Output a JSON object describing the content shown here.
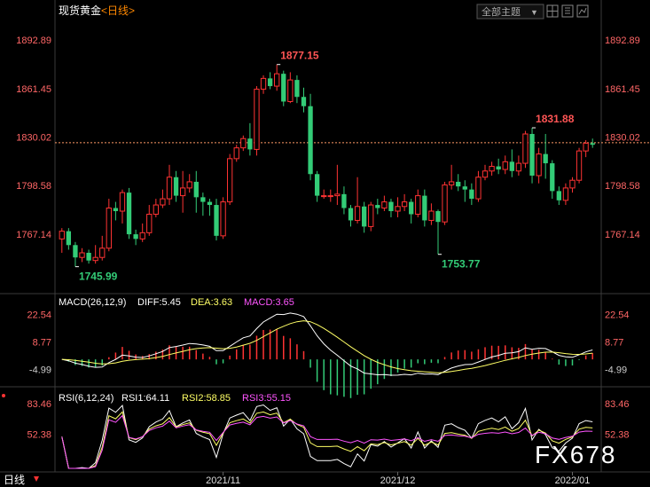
{
  "header": {
    "instrument": "现货黄金",
    "period": "<日线>",
    "theme_button": "全部主题",
    "theme_arrow": "▼"
  },
  "colors": {
    "up": "#ff3333",
    "down": "#33cc77",
    "axis_text_up": "#ff6666",
    "diff": "#ffffff",
    "dea": "#ffff66",
    "macd": "#ff55ff",
    "rsi2": "#ffff66",
    "rsi3": "#ff55ff",
    "grid": "#333333",
    "last_price_line": "#ff9966"
  },
  "price_axis": {
    "labels": [
      "1892.89",
      "1861.45",
      "1830.02",
      "1798.58",
      "1767.14"
    ],
    "values": [
      1892.89,
      1861.45,
      1830.02,
      1798.58,
      1767.14
    ],
    "range": [
      1732,
      1905
    ]
  },
  "annotations": {
    "high": "1877.15",
    "mid_high": "1831.88",
    "low1": "1745.99",
    "low2": "1753.77"
  },
  "macd": {
    "title": "MACD(26,12,9)",
    "diff_label": "DIFF:5.45",
    "dea_label": "DEA:3.63",
    "macd_label": "MACD:3.65",
    "axis_labels": [
      "22.54",
      "8.77",
      "-4.99"
    ],
    "axis_values": [
      22.54,
      8.77,
      -4.99
    ]
  },
  "rsi": {
    "title": "RSI(6,12,24)",
    "rsi1_label": "RSI1:64.11",
    "rsi2_label": "RSI2:58.85",
    "rsi3_label": "RSI3:55.15",
    "axis_labels": [
      "83.46",
      "52.38"
    ],
    "axis_values": [
      83.46,
      52.38
    ]
  },
  "footer": {
    "period_label": "日线",
    "dates": [
      "2021/11",
      "2021/12",
      "2022/01"
    ]
  },
  "watermark": "FX678",
  "chart_data": {
    "type": "candlestick",
    "candles": [
      [
        1764,
        1769,
        1755,
        1771
      ],
      [
        1769,
        1760,
        1757,
        1771
      ],
      [
        1760,
        1752,
        1746,
        1762
      ],
      [
        1752,
        1755,
        1749,
        1758
      ],
      [
        1755,
        1750,
        1748,
        1757
      ],
      [
        1750,
        1752,
        1748,
        1760
      ],
      [
        1752,
        1758,
        1750,
        1766
      ],
      [
        1758,
        1784,
        1756,
        1790
      ],
      [
        1784,
        1782,
        1776,
        1788
      ],
      [
        1782,
        1794,
        1774,
        1796
      ],
      [
        1794,
        1767,
        1764,
        1797
      ],
      [
        1767,
        1764,
        1760,
        1770
      ],
      [
        1764,
        1768,
        1762,
        1774
      ],
      [
        1768,
        1780,
        1766,
        1786
      ],
      [
        1780,
        1786,
        1778,
        1790
      ],
      [
        1786,
        1790,
        1784,
        1796
      ],
      [
        1790,
        1804,
        1786,
        1812
      ],
      [
        1804,
        1792,
        1788,
        1808
      ],
      [
        1792,
        1797,
        1781,
        1808
      ],
      [
        1797,
        1801,
        1794,
        1806
      ],
      [
        1801,
        1791,
        1781,
        1808
      ],
      [
        1791,
        1788,
        1779,
        1794
      ],
      [
        1788,
        1786,
        1779,
        1790
      ],
      [
        1786,
        1766,
        1763,
        1790
      ],
      [
        1766,
        1788,
        1764,
        1791
      ],
      [
        1788,
        1816,
        1786,
        1819
      ],
      [
        1816,
        1823,
        1814,
        1825
      ],
      [
        1823,
        1829,
        1821,
        1831
      ],
      [
        1829,
        1822,
        1818,
        1839
      ],
      [
        1822,
        1861,
        1818,
        1863
      ],
      [
        1861,
        1868,
        1858,
        1870
      ],
      [
        1868,
        1863,
        1861,
        1872
      ],
      [
        1863,
        1871,
        1860,
        1877
      ],
      [
        1871,
        1853,
        1850,
        1873
      ],
      [
        1853,
        1867,
        1852,
        1872
      ],
      [
        1867,
        1856,
        1852,
        1870
      ],
      [
        1856,
        1850,
        1846,
        1862
      ],
      [
        1850,
        1806,
        1802,
        1858
      ],
      [
        1806,
        1792,
        1788,
        1808
      ],
      [
        1792,
        1792,
        1790,
        1796
      ],
      [
        1792,
        1792,
        1788,
        1796
      ],
      [
        1792,
        1793,
        1786,
        1812
      ],
      [
        1793,
        1784,
        1780,
        1798
      ],
      [
        1784,
        1776,
        1772,
        1786
      ],
      [
        1776,
        1785,
        1774,
        1804
      ],
      [
        1785,
        1772,
        1768,
        1788
      ],
      [
        1772,
        1786,
        1769,
        1788
      ],
      [
        1786,
        1784,
        1780,
        1790
      ],
      [
        1784,
        1788,
        1782,
        1792
      ],
      [
        1788,
        1782,
        1778,
        1790
      ],
      [
        1782,
        1785,
        1778,
        1791
      ],
      [
        1785,
        1788,
        1782,
        1793
      ],
      [
        1788,
        1780,
        1774,
        1790
      ],
      [
        1780,
        1792,
        1778,
        1796
      ],
      [
        1792,
        1776,
        1772,
        1796
      ],
      [
        1776,
        1782,
        1773,
        1787
      ],
      [
        1782,
        1775,
        1754,
        1783
      ],
      [
        1775,
        1799,
        1773,
        1801
      ],
      [
        1799,
        1801,
        1796,
        1812
      ],
      [
        1801,
        1798,
        1795,
        1806
      ],
      [
        1798,
        1796,
        1788,
        1802
      ],
      [
        1796,
        1790,
        1786,
        1800
      ],
      [
        1790,
        1804,
        1788,
        1808
      ],
      [
        1804,
        1808,
        1802,
        1812
      ],
      [
        1808,
        1811,
        1805,
        1814
      ],
      [
        1811,
        1809,
        1806,
        1816
      ],
      [
        1809,
        1814,
        1806,
        1818
      ],
      [
        1814,
        1808,
        1804,
        1822
      ],
      [
        1808,
        1813,
        1805,
        1818
      ],
      [
        1813,
        1832,
        1810,
        1834
      ],
      [
        1832,
        1805,
        1800,
        1836
      ],
      [
        1805,
        1819,
        1800,
        1823
      ],
      [
        1819,
        1813,
        1803,
        1832
      ],
      [
        1813,
        1795,
        1790,
        1815
      ],
      [
        1795,
        1789,
        1786,
        1798
      ],
      [
        1789,
        1797,
        1786,
        1800
      ],
      [
        1797,
        1802,
        1794,
        1804
      ],
      [
        1802,
        1821,
        1800,
        1823
      ],
      [
        1821,
        1826,
        1817,
        1828
      ],
      [
        1826,
        1825,
        1823,
        1829
      ]
    ],
    "last_price": 1826.3,
    "macd_hist_range": [
      -20,
      30
    ],
    "macd_line_range": [
      -12,
      30
    ],
    "rsi_range": [
      18,
      95
    ]
  }
}
